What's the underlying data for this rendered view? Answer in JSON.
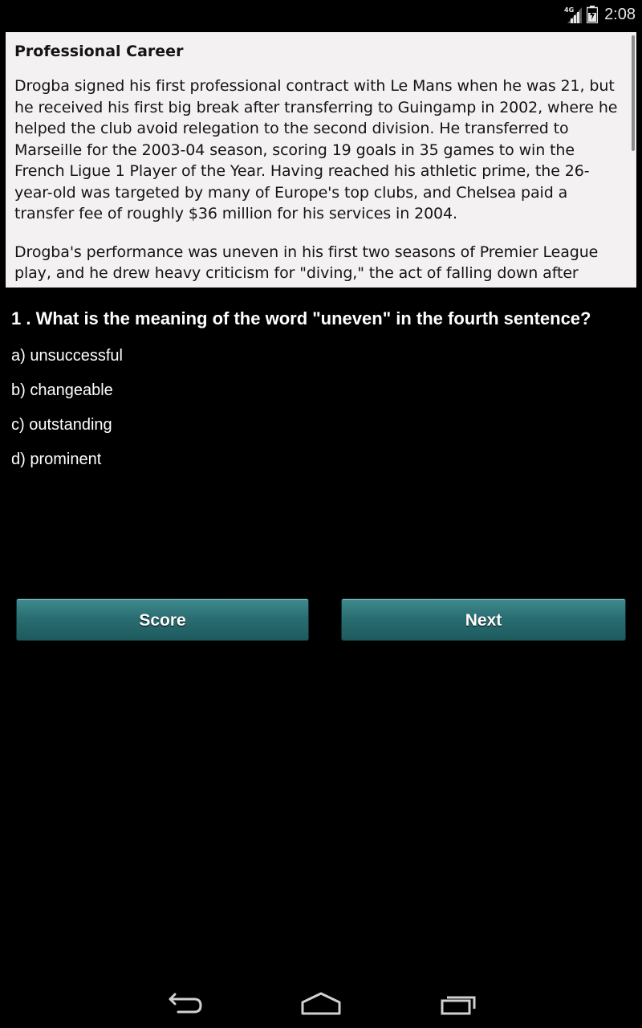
{
  "status_bar": {
    "network": "4G",
    "time": "2:08"
  },
  "article": {
    "title": "Professional Career",
    "paragraphs": [
      "Drogba signed his first professional contract with Le Mans when he was 21, but he received his first big break after transferring to Guingamp in 2002, where he helped the club avoid relegation to the second division. He transferred to Marseille for the 2003-04 season, scoring 19 goals in 35 games to win the French Ligue 1 Player of the Year. Having reached his athletic prime, the 26-year-old was targeted by many of Europe's top clubs, and Chelsea paid a transfer fee of roughly $36 million for his services in 2004.",
      "Drogba's performance was uneven in his first two seasons of Premier League play, and he drew heavy criticism for \"diving,\" the act of falling down after"
    ]
  },
  "quiz": {
    "question": "1 . What is the meaning of the word \"uneven\" in the fourth sentence?",
    "options": [
      "a) unsuccessful",
      "b) changeable",
      "c) outstanding",
      "d) prominent"
    ]
  },
  "buttons": {
    "score_label": "Score",
    "next_label": "Next"
  },
  "nav_icons": [
    "back-icon",
    "home-icon",
    "recent-apps-icon"
  ],
  "colors": {
    "button_top": "#3f8a8e",
    "button_bottom": "#1d5a5e",
    "panel_bg": "#f4f1f2"
  }
}
